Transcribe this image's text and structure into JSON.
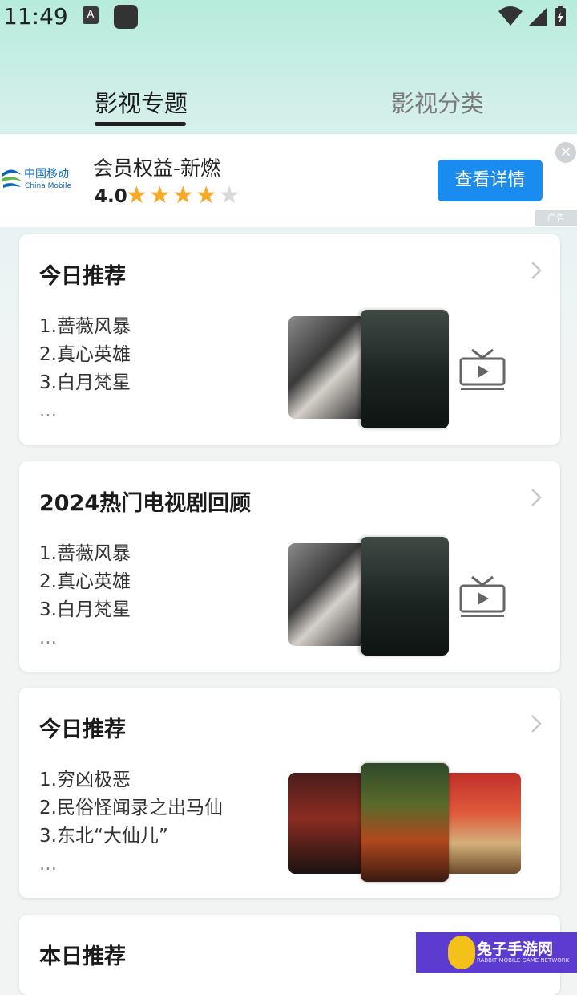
{
  "status_bar": {
    "time": "11:49",
    "notif_icon_label": "A"
  },
  "tabs": [
    {
      "label": "影视专题",
      "active": true
    },
    {
      "label": "影视分类",
      "active": false
    }
  ],
  "ad": {
    "logo_text": "中国移动",
    "logo_sub": "China Mobile",
    "title": "会员权益-新燃",
    "rating": "4.0",
    "stars_filled": 4,
    "stars_total": 5,
    "button": "查看详情",
    "close": "×",
    "tag": "广告"
  },
  "cards": [
    {
      "title": "今日推荐",
      "items": [
        "1.蔷薇风暴",
        "2.真心英雄",
        "3.白月梵星"
      ],
      "more": "..."
    },
    {
      "title": "2024热门电视剧回顾",
      "items": [
        "1.蔷薇风暴",
        "2.真心英雄",
        "3.白月梵星"
      ],
      "more": "..."
    },
    {
      "title": "今日推荐",
      "items": [
        "1.穷凶极恶",
        "2.民俗怪闻录之出马仙",
        "3.东北“大仙儿”"
      ],
      "more": "..."
    },
    {
      "title": "本日推荐"
    }
  ],
  "watermark": {
    "text": "兔子手游网",
    "sub": "RABBIT MOBILE GAME NETWORK"
  },
  "colors": {
    "accent": "#1a8cf0",
    "star": "#f7a928",
    "watermark_bg": "#5b3bd0"
  }
}
